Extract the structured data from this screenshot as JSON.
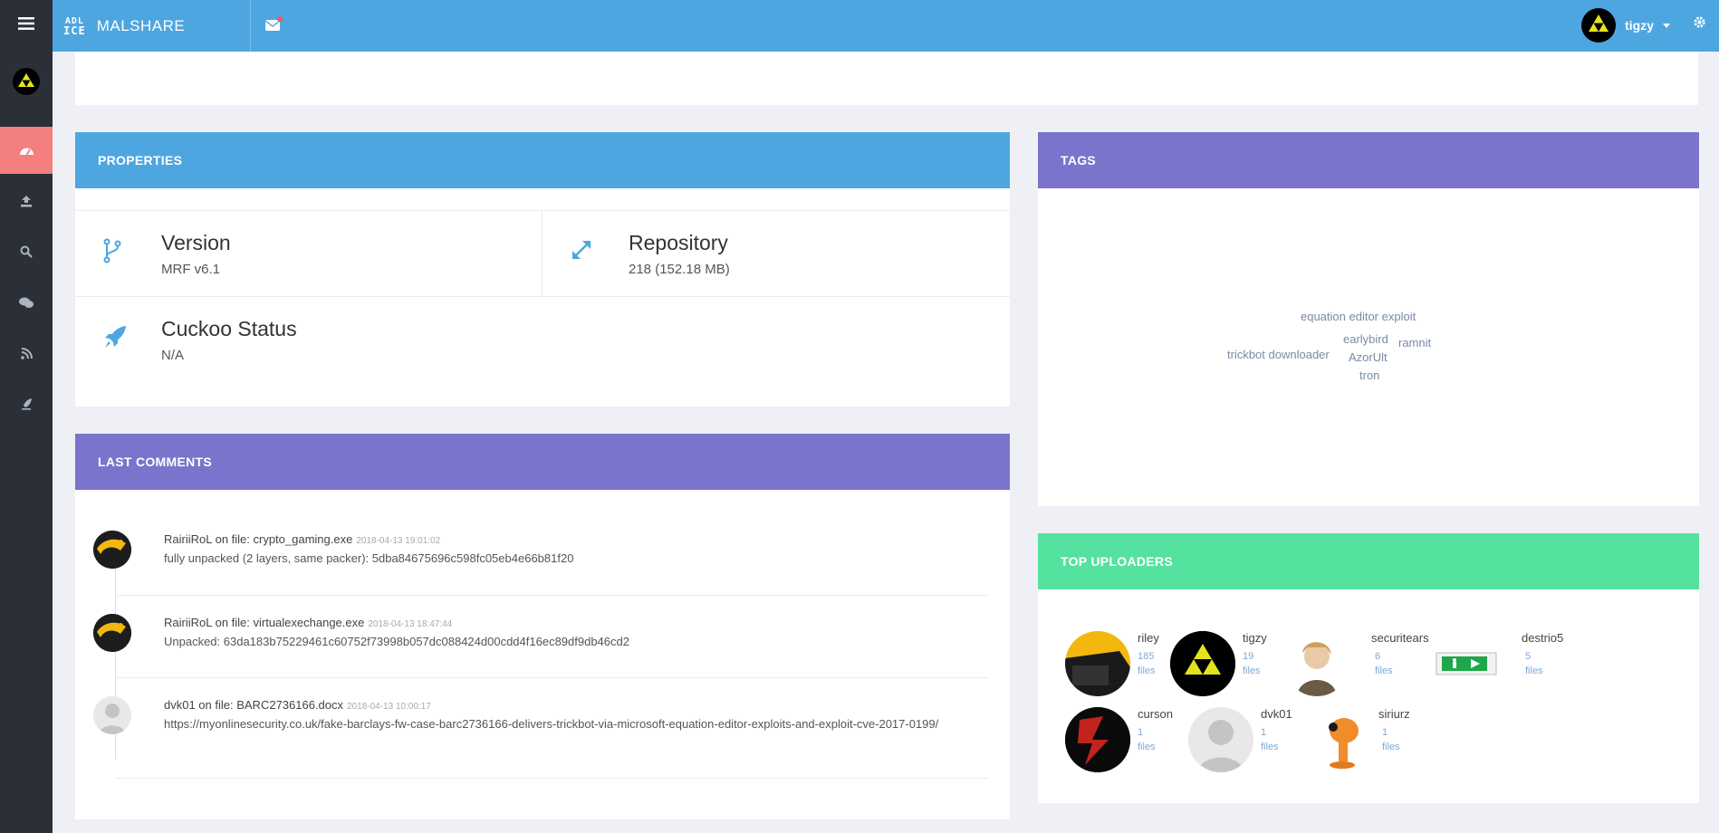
{
  "topbar": {
    "brand_logo_top": "ADL",
    "brand_logo_bottom": "ICE",
    "brand_name": "MALSHARE",
    "username": "tigzy"
  },
  "sidebar": {
    "items": [
      "menu-icon",
      "logo",
      "dashboard-icon",
      "upload-icon",
      "search-icon",
      "comments-icon",
      "rss-icon",
      "rocket-icon"
    ]
  },
  "colors": {
    "accent_blue": "#4ea6e0",
    "accent_purple": "#7a74cc",
    "accent_green": "#54e29e",
    "active_red": "#f37f7f"
  },
  "properties": {
    "title": "PROPERTIES",
    "version_label": "Version",
    "version_value": "MRF v6.1",
    "repository_label": "Repository",
    "repository_value": "218 (152.18 MB)",
    "cuckoo_label": "Cuckoo Status",
    "cuckoo_value": "N/A"
  },
  "tags": {
    "title": "TAGS",
    "items": [
      "equation editor exploit",
      "earlybird",
      "ramnit",
      "trickbot downloader",
      "AzorUlt",
      "tron"
    ]
  },
  "comments": {
    "title": "LAST COMMENTS",
    "items": [
      {
        "author_line": "RairiiRoL on file: crypto_gaming.exe",
        "date": "2018-04-13 19:01:02",
        "body": "fully unpacked (2 layers, same packer): 5dba84675696c598fc05eb4e66b81f20"
      },
      {
        "author_line": "RairiiRoL on file: virtualexechange.exe",
        "date": "2018-04-13 18:47:44",
        "body": "Unpacked: 63da183b75229461c60752f73998b057dc088424d00cdd4f16ec89df9db46cd2"
      },
      {
        "author_line": "dvk01 on file: BARC2736166.docx",
        "date": "2018-04-13 10:00:17",
        "body": "https://myonlinesecurity.co.uk/fake-barclays-fw-case-barc2736166-delivers-trickbot-via-microsoft-equation-editor-exploits-and-exploit-cve-2017-0199/"
      }
    ]
  },
  "uploaders": {
    "title": "TOP UPLOADERS",
    "items": [
      {
        "name": "riley",
        "count": "185",
        "unit": "files"
      },
      {
        "name": "tigzy",
        "count": "19",
        "unit": "files"
      },
      {
        "name": "securitears",
        "count": "6 files",
        "unit": ""
      },
      {
        "name": "destrio5",
        "count": "5 files",
        "unit": ""
      },
      {
        "name": "curson",
        "count": "1 files",
        "unit": ""
      },
      {
        "name": "dvk01",
        "count": "1 files",
        "unit": ""
      },
      {
        "name": "siriurz",
        "count": "1 files",
        "unit": ""
      }
    ]
  }
}
